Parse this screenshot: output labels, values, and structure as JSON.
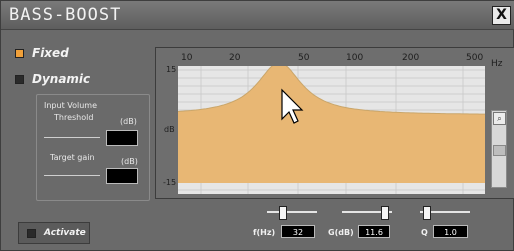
{
  "window": {
    "title": "BASS-BOOST",
    "close_label": "X"
  },
  "modes": {
    "fixed_label": "Fixed",
    "dynamic_label": "Dynamic",
    "selected": "Fixed"
  },
  "input_volume": {
    "group_label": "Input Volume",
    "threshold_label": "Threshold",
    "threshold_unit": "(dB)",
    "target_label": "Target gain",
    "target_unit": "(dB)"
  },
  "graph": {
    "freq_ticks": [
      "10",
      "20",
      "50",
      "100",
      "200",
      "500"
    ],
    "unit_label": "Hz",
    "y_top": "15",
    "y_mid": "dB",
    "y_bottom": "-15",
    "fill_color": "#e8b774",
    "curve_color": "#caa66a",
    "peak_marker_color": "#d07a2d"
  },
  "activate": {
    "label": "Activate"
  },
  "params": {
    "freq_label": "f(Hz)",
    "freq_value": "32",
    "gain_label": "G(dB)",
    "gain_value": "11.6",
    "q_label": "Q",
    "q_value": "1.0"
  }
}
